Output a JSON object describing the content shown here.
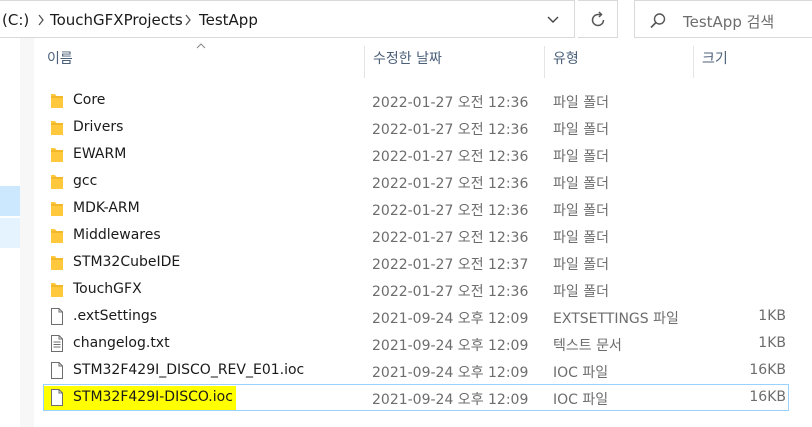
{
  "address": {
    "drive": "(C:)",
    "path": [
      "TouchGFXProjects",
      "TestApp"
    ]
  },
  "search": {
    "placeholder": "TestApp 검색"
  },
  "columns": {
    "name": "이름",
    "date": "수정한 날짜",
    "type": "유형",
    "size": "크기"
  },
  "colors": {
    "folder": "#ffc83d",
    "selection_border": "#99d1ff",
    "highlight": "#ffff00"
  },
  "files": [
    {
      "name": "Core",
      "date": "2022-01-27 오전 12:36",
      "type": "파일 폴더",
      "size": "",
      "icon": "folder-icon"
    },
    {
      "name": "Drivers",
      "date": "2022-01-27 오전 12:36",
      "type": "파일 폴더",
      "size": "",
      "icon": "folder-icon"
    },
    {
      "name": "EWARM",
      "date": "2022-01-27 오전 12:36",
      "type": "파일 폴더",
      "size": "",
      "icon": "folder-icon"
    },
    {
      "name": "gcc",
      "date": "2022-01-27 오전 12:36",
      "type": "파일 폴더",
      "size": "",
      "icon": "folder-icon"
    },
    {
      "name": "MDK-ARM",
      "date": "2022-01-27 오전 12:36",
      "type": "파일 폴더",
      "size": "",
      "icon": "folder-icon"
    },
    {
      "name": "Middlewares",
      "date": "2022-01-27 오전 12:36",
      "type": "파일 폴더",
      "size": "",
      "icon": "folder-icon"
    },
    {
      "name": "STM32CubeIDE",
      "date": "2022-01-27 오전 12:37",
      "type": "파일 폴더",
      "size": "",
      "icon": "folder-icon"
    },
    {
      "name": "TouchGFX",
      "date": "2022-01-27 오전 12:36",
      "type": "파일 폴더",
      "size": "",
      "icon": "folder-icon"
    },
    {
      "name": ".extSettings",
      "date": "2021-09-24 오후 12:09",
      "type": "EXTSETTINGS 파일",
      "size": "1KB",
      "icon": "file-icon"
    },
    {
      "name": "changelog.txt",
      "date": "2021-09-24 오후 12:09",
      "type": "텍스트 문서",
      "size": "1KB",
      "icon": "text-file-icon"
    },
    {
      "name": "STM32F429I_DISCO_REV_E01.ioc",
      "date": "2021-09-24 오후 12:09",
      "type": "IOC 파일",
      "size": "16KB",
      "icon": "file-icon"
    },
    {
      "name": "STM32F429I-DISCO.ioc",
      "date": "2021-09-24 오후 12:09",
      "type": "IOC 파일",
      "size": "16KB",
      "icon": "file-icon",
      "selected": true
    }
  ]
}
